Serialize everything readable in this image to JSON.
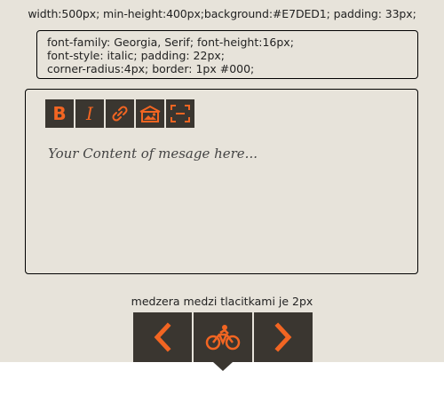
{
  "spec_top": "width:500px; min-height:400px;background:#E7DED1; padding: 33px;",
  "spec_box": {
    "line1": "font-family: Georgia, Serif; font-height:16px;",
    "line2": "font-style: italic; padding: 22px;",
    "line3": "corner-radius:4px; border: 1px #000;"
  },
  "toolbar": {
    "bold_label": "B",
    "italic_label": "I",
    "icons": [
      "bold-icon",
      "italic-icon",
      "link-icon",
      "image-icon",
      "fullscreen-icon"
    ]
  },
  "editor": {
    "placeholder": "Your Content of mesage here..."
  },
  "gap_note": "medzera medzi tlacitkami je 2px",
  "nav": {
    "icons": [
      "chevron-left-icon",
      "bicycle-icon",
      "chevron-right-icon"
    ]
  },
  "colors": {
    "background": "#E7E3DA",
    "button": "#3A3630",
    "accent": "#F26522",
    "border": "#000000"
  }
}
